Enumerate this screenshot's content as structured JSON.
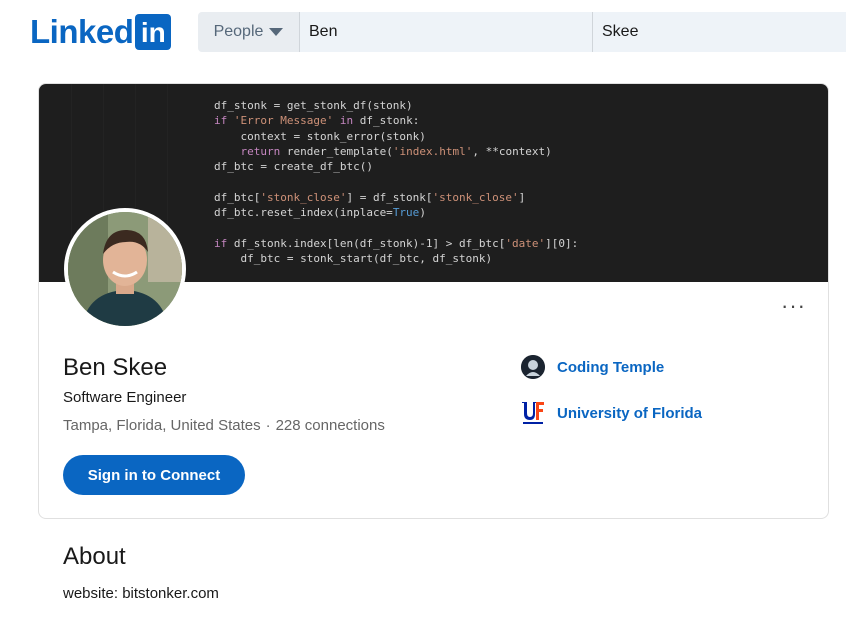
{
  "header": {
    "logo_text": "Linked",
    "logo_box": "in",
    "search": {
      "type_label": "People",
      "first_name": "Ben",
      "last_name": "Skee"
    }
  },
  "banner": {
    "code_lines": [
      "df_stonk = get_stonk_df(stonk)",
      "if 'Error Message' in df_stonk:",
      "    context = stonk_error(stonk)",
      "    return render_template('index.html', **context)",
      "df_btc = create_df_btc()",
      "",
      "df_btc['stonk_close'] = df_stonk['stonk_close']",
      "df_btc.reset_index(inplace=True)",
      "",
      "if df_stonk.index[len(df_stonk)-1] > df_btc['date'][0]:",
      "    df_btc = stonk_start(df_btc, df_stonk)"
    ]
  },
  "profile": {
    "name": "Ben Skee",
    "headline": "Software Engineer",
    "location": "Tampa, Florida, United States",
    "separator": "·",
    "connections": "228 connections",
    "connect_label": "Sign in to Connect",
    "more_label": "···",
    "orgs": [
      {
        "name": "Coding Temple",
        "icon": "coding-temple-logo"
      },
      {
        "name": "University of Florida",
        "icon": "uf-logo"
      }
    ]
  },
  "about": {
    "title": "About",
    "text": "website: bitstonker.com"
  },
  "colors": {
    "brand": "#0a66c2",
    "banner_bg": "#1e1e1e"
  }
}
